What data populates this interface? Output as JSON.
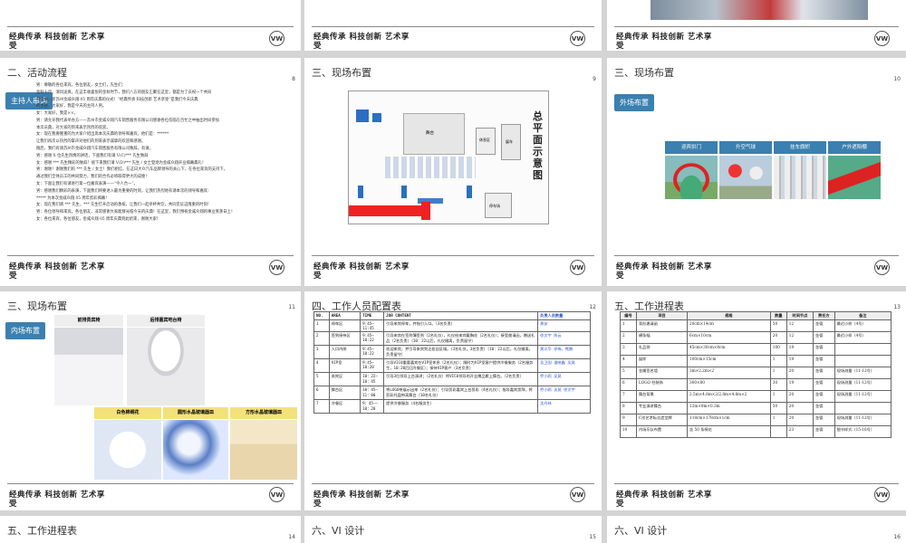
{
  "footer": {
    "text": "经典传承   科技创新   艺术享",
    "text2": "受",
    "logo": "VW"
  },
  "slides": {
    "p8": {
      "title": "二、活动流程",
      "page": "8",
      "tag": "主持人串词",
      "lines": [
        "男：尊敬的各位来宾，各位朋友，女士们，先生们：",
        "    金秋十月，清风送爽，在这丰收喜悦的金秋时节，我们八方的朋友汇聚在这里，都是为了庆祝一个共同",
        "的盛事，即苏州金威众翔 05 周年庆典的仪式！“经典传承  科技创新  艺术享受”是我们今天庆典",
        "    的主题，大家好，我是今天的主持人男。",
        "女：大家好，我是××。",
        "男：请允许我代表举办方——苏州市金威众翔汽车销售服务有限公司感谢各位莅临在百忙之中抽出时间参加",
        "    本次庆典，对大家的到来表示热烈的欢迎。",
        "女：现在我要隆重的为大家介绍出席本次庆典的领导和嘉宾，他们是：******",
        "    让我们再次以热烈的掌声对他们的到来表示诚挚的欢迎和感谢。",
        "    随后，我们有请苏州市金威众翔汽车销售服务有限公司致辞，有请。",
        "男：感谢 X 位先生热情的讲话，下面我们有请 V(C)*** 先生致辞",
        "女：感谢 *** 先生精彩的致辞！接下来我们请 V(D)*** 先生 / 女士登场为金威众翔开业揭幕典礼！",
        "男：谢谢！谢谢我们的 *** 先生 / 女士！我们相信，在这日大众汽车品牌领导的关心下，在各位来宾的支持下，",
        "    通过我们全体员工的共同努力，我们的合作必将取得更大的成绩！",
        "女：下面让我们有请进行第一位嘉宾表演——“今人合一”。",
        "男：感谢我们精彩的表演，下面我们将要进入最为重要的时刻，让我们热烈地有请本次的领导和嘉宾：",
        "    ***** 为本次金威众翔 05 周年剪彩揭幕！",
        "女：现在我们请 *** 先生，*** 先生打开启动的香槟，让我们一起举杯共饮，共同见证这隆重的时刻！",
        "男：各位领导和来宾，各位朋友，非常感谢大家能够光临今天的庆典！在这里，我们预祝金威众翔的事业蒸蒸日上！",
        "女：各位来宾，各位朋友，金威众翔 05 周年庆典到此结束，谢谢大家！"
      ]
    },
    "p9": {
      "title": "三、现场布置",
      "page": "9",
      "plan_title": "总平面示意图",
      "labels": {
        "stage": "舞台",
        "entrance": "入口",
        "sign": "签到区",
        "vip": "贵宾区",
        "bar": "吧台",
        "show": "展车",
        "rest": "休息区",
        "bottom": "停车场"
      }
    },
    "p10": {
      "title": "三、现场布置",
      "page": "10",
      "tag": "外场布置",
      "items": [
        "迎宾拱门",
        "升空气球",
        "挂车旗帜",
        "户外遮阳棚"
      ]
    },
    "p11": {
      "title": "三、现场布置",
      "page": "11",
      "tag": "内场布置",
      "items": [
        "前排贵宾椅",
        "后排嘉宾吧台椅",
        "白色棉绸花",
        "圆形水晶玻璃器皿",
        "方形水晶玻璃器皿"
      ]
    },
    "p12": {
      "title": "四、工作人员配置表",
      "page": "12",
      "headers": [
        "NO.",
        "AREA",
        "TIME",
        "JOB CONTENT",
        "负责人员数量"
      ],
      "rows": [
        [
          "1",
          "停车区",
          "9:45—11:45",
          "引导来宾停车，并指引入口。（3名负责）",
          "黄安"
        ],
        [
          "2",
          "签到接待区",
          "9:45—10:22",
          "引导来宾在签到簿签到（2名礼仪），礼仪给来宾戴胸花（2名礼仪）；接受邀请函，赠送礼品（2名负责）（10：22以后，礼仪撤离，负责留守）",
          "徐文宇  陈云"
        ],
        [
          "3",
          "入口内侧",
          "9:45—10:22",
          "欢迎来宾，并引导来宾到达各自区域。（3名礼仪，3名负责）（10：22以后，礼仪撤离，负责留守）",
          "黄义华  徐梅，熊鹏"
        ],
        [
          "4",
          "VIP室",
          "9:45—10:20",
          "引导VIC0重要嘉宾在VIP室休息（2名礼仪）；随时为VIP室客户提供冷餐服务（2名服务生，10:20后回冷餐区）；接待VIP客户（3名负责）",
          "吴卫国  潘晓鑫  吴晃"
        ],
        [
          "5",
          "贵宾区",
          "10：22—10：45",
          "引导3位领导上台演讲；（2名礼仪）将VIC0领导的开业赠品搬上舞台。（2名负责）",
          "乔小鸥  吴晃"
        ],
        [
          "6",
          "舞台区",
          "10：45—11：00",
          "将LOGO带展示出来（2名礼仪）；引导剪彩嘉宾上台剪彩（4名礼仪）；指导嘉宾崇拜，将剪彩托盘带离舞台（10名礼仪）",
          "乔小鸥  吴晃  徐文宇"
        ],
        [
          "7",
          "冷餐区",
          "9：45——10：20",
          "提供冷餐服务（4名服务生）",
          "沈丹林"
        ]
      ]
    },
    "p13": {
      "title": "五、工作进程表",
      "page": "13",
      "headers": [
        "编号",
        "项目",
        "规格",
        "数量",
        "时间节点",
        "责任方",
        "备注"
      ],
      "rows": [
        [
          "1",
          "背形邀请函",
          "20cm×14cm",
          "50",
          "12",
          "金德",
          "最迟小样（4号）"
        ],
        [
          "2",
          "横条幅",
          "6cm×10cm",
          "20",
          "12",
          "金德",
          "最迟小样（4号）"
        ],
        [
          "3",
          "礼品袋",
          "45cm×30cm×8cm",
          "100",
          "19",
          "金德",
          ""
        ],
        [
          "4",
          "展样",
          "100cm×15cm",
          "1",
          "19",
          "金德",
          ""
        ],
        [
          "5",
          "金属签名墙",
          "3m×2.2m×2",
          "1",
          "20",
          "金德",
          "现场测量（11-12号）"
        ],
        [
          "6",
          "LOGO 柱装饰",
          "300×80",
          "30",
          "19",
          "金德",
          "现场测量（11-12号）"
        ],
        [
          "7",
          "舞台背景",
          "2.5m×4.8m×2/2.8m×4.8m×2",
          "1",
          "20",
          "金德",
          "现场测量（11-12号）"
        ],
        [
          "8",
          "专业演讲舞台",
          "12m×8m×0.3m",
          "50",
          "20",
          "金德",
          ""
        ],
        [
          "9",
          "C形艺术标志造型牌",
          "118cm×178cm×1cm",
          "1",
          "20",
          "金德",
          "现场测量（11-12号）"
        ],
        [
          "10",
          "内场乐队布置",
          "含 50 条椅花",
          "",
          "23",
          "金德",
          "细节样式（15-16号）"
        ]
      ]
    },
    "p14": {
      "title": "五、工作进程表",
      "page": "14"
    },
    "p15": {
      "title": "六、VI 设计",
      "page": "15"
    },
    "p16": {
      "title": "六、VI 设计",
      "page": "16"
    }
  }
}
